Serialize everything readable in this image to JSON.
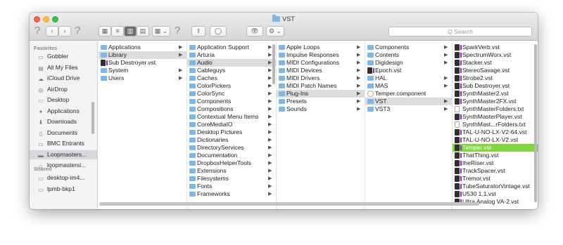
{
  "window": {
    "title": "VST"
  },
  "toolbar": {
    "back": "‹",
    "forward": "›",
    "help": "?",
    "view_icons": "▦",
    "view_list": "≡",
    "view_columns": "▥",
    "view_coverflow": "▤",
    "arrange": "▦ ⌄",
    "share": "⇪",
    "tags": "◯",
    "quicklook": "👁",
    "action": "⚙ ⌄",
    "search_placeholder": "Q Search"
  },
  "sidebar": {
    "favorites_heading": "Favorites",
    "favorites": [
      {
        "label": "Gobbler",
        "icon": "folder-icon"
      },
      {
        "label": "All My Files",
        "icon": "files-icon"
      },
      {
        "label": "iCloud Drive",
        "icon": "cloud-icon"
      },
      {
        "label": "AirDrop",
        "icon": "airdrop-icon"
      },
      {
        "label": "Desktop",
        "icon": "desktop-icon"
      },
      {
        "label": "Applications",
        "icon": "applications-icon"
      },
      {
        "label": "Downloads",
        "icon": "downloads-icon"
      },
      {
        "label": "Documents",
        "icon": "documents-icon"
      },
      {
        "label": "BMC Entrants",
        "icon": "folder-icon"
      },
      {
        "label": "Loopmasters...",
        "icon": "drive-icon"
      },
      {
        "label": "loopmastersi...",
        "icon": "home-icon"
      }
    ],
    "shared_heading": "Shared",
    "shared": [
      {
        "label": "desktop-im4...",
        "icon": "computer-icon"
      },
      {
        "label": "lpmb-bkp1",
        "icon": "computer-icon"
      }
    ]
  },
  "columns": [
    {
      "items": [
        "Applications",
        "Library",
        "Sub Destroyer.vst",
        "System",
        "Users"
      ],
      "selected": 1
    },
    {
      "items": [
        "Application Support",
        "Arturia",
        "Audio",
        "Cableguys",
        "Caches",
        "ColorPickers",
        "ColorSync",
        "Components",
        "Compositions",
        "Contextual Menu Items",
        "CoreMediaIO",
        "Desktop Pictures",
        "Dictionaries",
        "DirectoryServices",
        "Documentation",
        "DropboxHelperTools",
        "Extensions",
        "Filesystems",
        "Fonts",
        "Frameworks"
      ],
      "selected": 2
    },
    {
      "items": [
        "Apple Loops",
        "Impulse Responses",
        "MIDI Configurations",
        "MIDI Devices",
        "MIDI Drivers",
        "MIDI Patch Names",
        "Plug-Ins",
        "Presets",
        "Sounds"
      ],
      "selected": 6
    },
    {
      "items": [
        "Components",
        "Contents",
        "Digidesign",
        "Epoch.vst",
        "HAL",
        "MAS",
        "Temper.component",
        "VST",
        "VST3"
      ],
      "selected": 7
    },
    {
      "items": [
        "SparkVerb.vst",
        "SpectrumWorx.vst",
        "Stacker.vst",
        "StereoSavage.vst",
        "Strobe2.vst",
        "Sub Destroyer.vst",
        "SynthMaster2.vst",
        "SynthMaster2FX.vst",
        "SynthMasterFolders.txt",
        "SynthMasterPlayer.vst",
        "SynthMast...rFolders.txt",
        "TAL-U-NO-LX-V2-64.vst",
        "TAL-U-NO-LX-V2.vst",
        "Temper.vst",
        "ThatThing.vst",
        "theRiser.vst",
        "TrackSpacer.vst",
        "Tremor.vst",
        "TubeSaturatorVintage.vst",
        "U530 1.1.vst",
        "Ultra Analog VA-2.vst"
      ],
      "selected": 13
    }
  ],
  "colors": {
    "selection": "#7fd73e",
    "folder": "#7db7e8"
  }
}
